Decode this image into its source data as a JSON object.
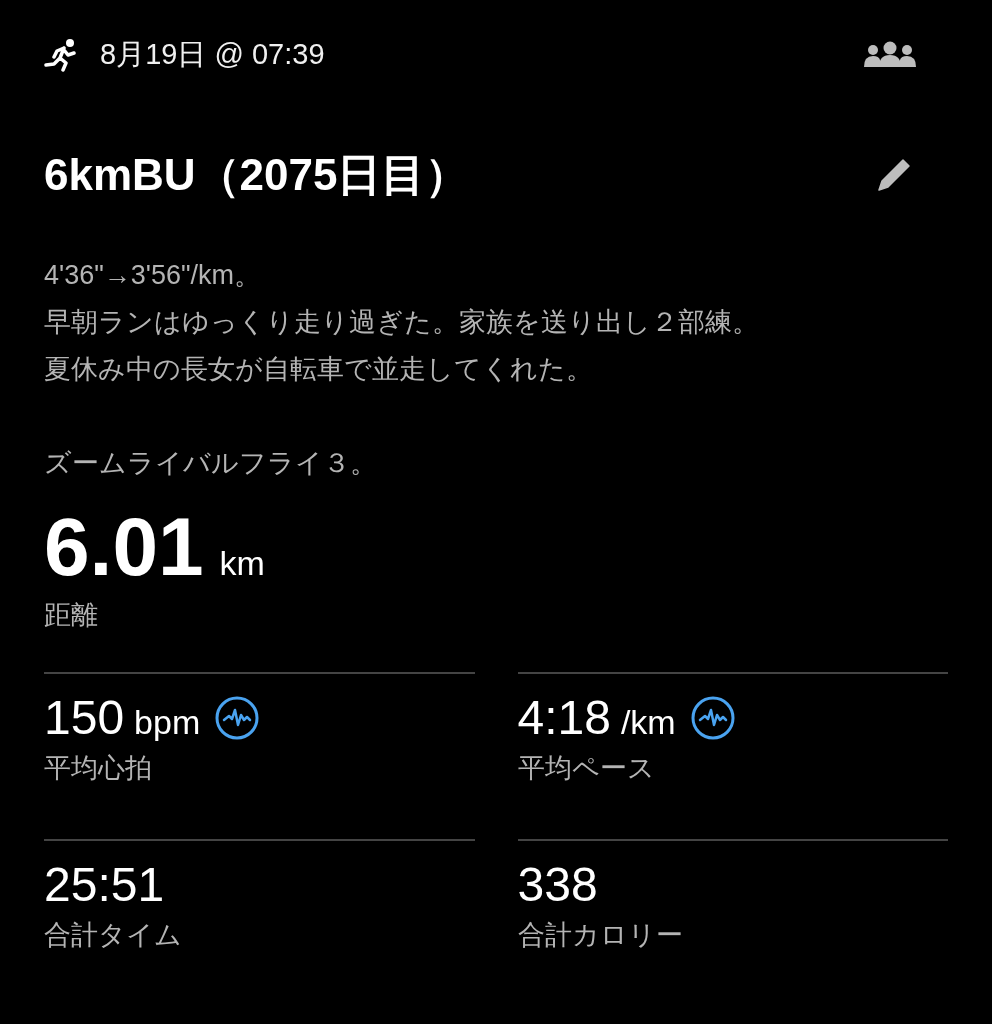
{
  "header": {
    "datetime": "8月19日 @ 07:39"
  },
  "title": "6kmBU（2075日目）",
  "description": [
    "4'36\"→3'56\"/km。",
    "早朝ランはゆっくり走り過ぎた。家族を送り出し２部練。",
    "夏休み中の長女が自転車で並走してくれた。"
  ],
  "note": "ズームライバルフライ３。",
  "distance": {
    "value": "6.01",
    "unit": "km",
    "label": "距離"
  },
  "stats": [
    {
      "value": "150",
      "unit": "bpm",
      "label": "平均心拍",
      "has_chart": true
    },
    {
      "value": "4:18",
      "unit": "/km",
      "label": "平均ペース",
      "has_chart": true
    },
    {
      "value": "25:51",
      "label": "合計タイム",
      "has_chart": false
    },
    {
      "value": "338",
      "label": "合計カロリー",
      "has_chart": false
    }
  ]
}
